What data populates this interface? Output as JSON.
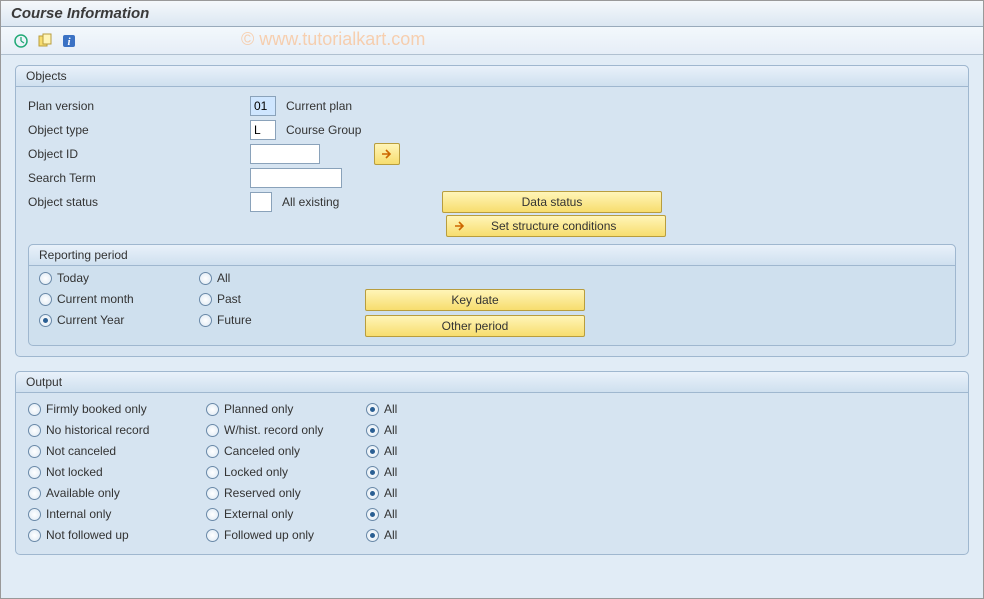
{
  "title": "Course Information",
  "watermark": "© www.tutorialkart.com",
  "objects": {
    "legend": "Objects",
    "plan_version": {
      "label": "Plan version",
      "value": "01",
      "desc": "Current plan"
    },
    "object_type": {
      "label": "Object type",
      "value": "L",
      "desc": "Course Group"
    },
    "object_id": {
      "label": "Object ID",
      "value": ""
    },
    "search_term": {
      "label": "Search Term",
      "value": ""
    },
    "object_status": {
      "label": "Object status",
      "value": "",
      "desc": "All existing"
    },
    "btn_data_status": "Data status",
    "btn_set_structure": "Set structure conditions"
  },
  "reporting": {
    "legend": "Reporting period",
    "col1": [
      {
        "label": "Today",
        "checked": false
      },
      {
        "label": "Current month",
        "checked": false
      },
      {
        "label": "Current Year",
        "checked": true
      }
    ],
    "col2": [
      {
        "label": "All",
        "checked": false
      },
      {
        "label": "Past",
        "checked": false
      },
      {
        "label": "Future",
        "checked": false
      }
    ],
    "btn_key_date": "Key date",
    "btn_other_period": "Other period"
  },
  "output": {
    "legend": "Output",
    "rows": [
      {
        "c1": "Firmly booked only",
        "c2": "Planned only",
        "c3": "All",
        "sel": "c3"
      },
      {
        "c1": "No historical record",
        "c2": "W/hist. record only",
        "c3": "All",
        "sel": "c3"
      },
      {
        "c1": "Not canceled",
        "c2": "Canceled only",
        "c3": "All",
        "sel": "c3"
      },
      {
        "c1": "Not locked",
        "c2": "Locked only",
        "c3": "All",
        "sel": "c3"
      },
      {
        "c1": "Available only",
        "c2": "Reserved only",
        "c3": "All",
        "sel": "c3"
      },
      {
        "c1": "Internal only",
        "c2": "External only",
        "c3": "All",
        "sel": "c3"
      },
      {
        "c1": "Not followed up",
        "c2": "Followed up only",
        "c3": "All",
        "sel": "c3"
      }
    ]
  }
}
